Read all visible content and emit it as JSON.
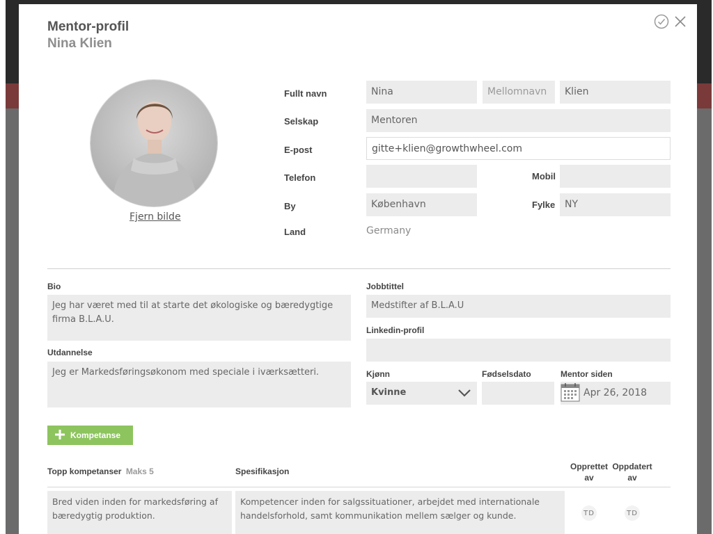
{
  "header": {
    "title": "Mentor-profil",
    "subtitle": "Nina Klien"
  },
  "profile": {
    "remove_photo": "Fjern bilde"
  },
  "form": {
    "full_name_label": "Fullt navn",
    "first_name": "Nina",
    "middle_name_placeholder": "Mellomnavn",
    "last_name": "Klien",
    "company_label": "Selskap",
    "company": "Mentoren",
    "email_label": "E-post",
    "email": "gitte+klien@growthwheel.com",
    "phone_label": "Telefon",
    "phone": "",
    "mobile_label": "Mobil",
    "mobile": "",
    "city_label": "By",
    "city": "København",
    "county_label": "Fylke",
    "county": "NY",
    "country_label": "Land",
    "country": "Germany"
  },
  "details": {
    "bio_label": "Bio",
    "bio": "Jeg har været med til at starte det økologiske og bæredygtige firma B.L.A.U.",
    "education_label": "Utdannelse",
    "education": "Jeg er Markedsføringsøkonom med speciale i iværksætteri.",
    "job_title_label": "Jobbtittel",
    "job_title": "Medstifter af B.L.A.U",
    "linkedin_label": "Linkedin-profil",
    "linkedin": "",
    "gender_label": "Kjønn",
    "gender": "Kvinne",
    "birthdate_label": "Fødselsdato",
    "birthdate": "",
    "mentor_since_label": "Mentor siden",
    "mentor_since": "Apr 26, 2018"
  },
  "competence": {
    "add_button": "Kompetanse",
    "col_top": "Topp kompetanser",
    "col_top_note": "Maks 5",
    "col_spec": "Spesifikasjon",
    "col_created_1": "Opprettet",
    "col_created_2": "av",
    "col_updated_1": "Oppdatert",
    "col_updated_2": "av",
    "rows": [
      {
        "name": "Bred viden inden for markedsføring af bæredygtig produktion.",
        "spec": "Kompetencer inden for salgssituationer, arbejdet med internationale handelsforhold, samt kommunikation mellem sælger og kunde.",
        "created_by": "TD",
        "updated_by": "TD"
      }
    ]
  },
  "colors": {
    "accent_green": "#8dc45e",
    "field_bg": "#ececec"
  },
  "icons": [
    "check-circle-icon",
    "close-icon",
    "plus-icon",
    "chevron-down-icon",
    "calendar-icon"
  ]
}
